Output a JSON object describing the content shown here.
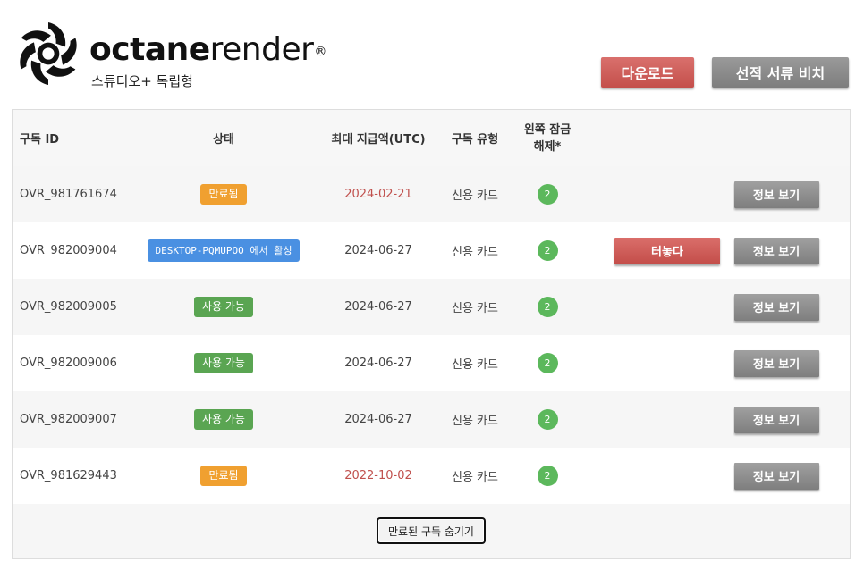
{
  "brand": {
    "name_bold": "octane",
    "name_light": "render",
    "registered": "®",
    "edition": "스튜디오+ 독립형"
  },
  "actions": {
    "download_label": "다운로드",
    "invoice_label": "선적 서류 비치"
  },
  "table": {
    "headers": {
      "id": "구독 ID",
      "status": "상태",
      "max_payment": "최대 지급액(UTC)",
      "type": "구독 유형",
      "unlock": "왼쪽 잠금 해제*"
    },
    "rows": [
      {
        "id": "OVR_981761674",
        "status": "만료됨",
        "status_kind": "expired",
        "date": "2024-02-21",
        "date_expired": true,
        "type": "신용 카드",
        "unlock": "2",
        "detach": "",
        "info": "정보 보기"
      },
      {
        "id": "OVR_982009004",
        "status": "DESKTOP-PQMUPOO 에서 활성",
        "status_kind": "active",
        "date": "2024-06-27",
        "date_expired": false,
        "type": "신용 카드",
        "unlock": "2",
        "detach": "터놓다",
        "info": "정보 보기"
      },
      {
        "id": "OVR_982009005",
        "status": "사용 가능",
        "status_kind": "available",
        "date": "2024-06-27",
        "date_expired": false,
        "type": "신용 카드",
        "unlock": "2",
        "detach": "",
        "info": "정보 보기"
      },
      {
        "id": "OVR_982009006",
        "status": "사용 가능",
        "status_kind": "available",
        "date": "2024-06-27",
        "date_expired": false,
        "type": "신용 카드",
        "unlock": "2",
        "detach": "",
        "info": "정보 보기"
      },
      {
        "id": "OVR_982009007",
        "status": "사용 가능",
        "status_kind": "available",
        "date": "2024-06-27",
        "date_expired": false,
        "type": "신용 카드",
        "unlock": "2",
        "detach": "",
        "info": "정보 보기"
      },
      {
        "id": "OVR_981629443",
        "status": "만료됨",
        "status_kind": "expired",
        "date": "2022-10-02",
        "date_expired": true,
        "type": "신용 카드",
        "unlock": "2",
        "detach": "",
        "info": "정보 보기"
      }
    ],
    "hide_expired_label": "만료된 구독 숨기기"
  },
  "colors": {
    "expired_badge": "#f0a030",
    "available_badge": "#5aa552",
    "active_badge": "#4a90e2",
    "expired_date": "#c0504d",
    "unlock_circle": "#5cb85c",
    "download_button": "#c44f4b",
    "gray_button": "#7e7e7e"
  }
}
